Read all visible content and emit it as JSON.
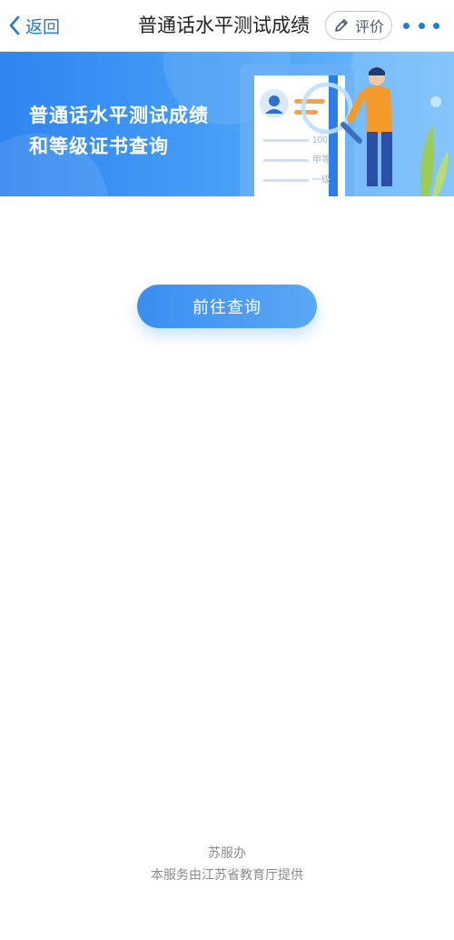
{
  "nav": {
    "back_label": "返回",
    "title": "普通话水平测试成绩",
    "rate_label": "评价",
    "accent_color": "#1e7bd6"
  },
  "banner": {
    "line1": "普通话水平测试成绩",
    "line2": "和等级证书查询",
    "illustration": {
      "score": "100",
      "grade": "甲等",
      "level": "一级"
    }
  },
  "main": {
    "query_button_label": "前往查询"
  },
  "footer": {
    "org": "苏服办",
    "provider": "本服务由江苏省教育厅提供"
  },
  "icons": {
    "back": "chevron-left-icon",
    "rate": "pencil-icon",
    "more": "more-dots-icon"
  }
}
